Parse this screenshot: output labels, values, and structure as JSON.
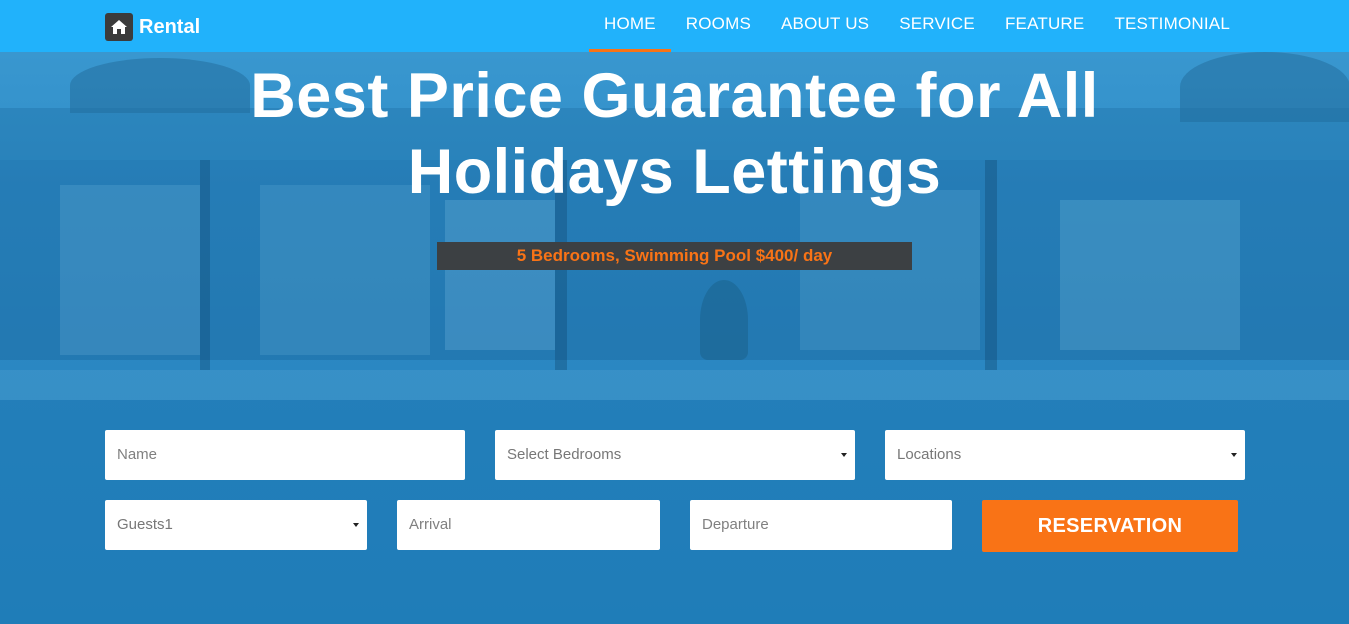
{
  "brand": {
    "name": "Rental",
    "icon": "home-icon"
  },
  "nav": {
    "items": [
      {
        "label": "HOME",
        "active": true
      },
      {
        "label": "ROOMS",
        "active": false
      },
      {
        "label": "ABOUT US",
        "active": false
      },
      {
        "label": "SERVICE",
        "active": false
      },
      {
        "label": "FEATURE",
        "active": false
      },
      {
        "label": "TESTIMONIAL",
        "active": false
      }
    ]
  },
  "hero": {
    "headline_line1": "Best Price Guarantee for All",
    "headline_line2": "Holidays Lettings",
    "promo": "5 Bedrooms, Swimming Pool $400/ day"
  },
  "form": {
    "name_placeholder": "Name",
    "bedrooms_value": "Select Bedrooms",
    "locations_value": "Locations",
    "guests_value": "Guests1",
    "arrival_placeholder": "Arrival",
    "departure_placeholder": "Departure",
    "reservation_label": "RESERVATION"
  },
  "colors": {
    "navbar": "#21b2fb",
    "accent": "#f97316",
    "promo_bg": "#3c4043"
  }
}
